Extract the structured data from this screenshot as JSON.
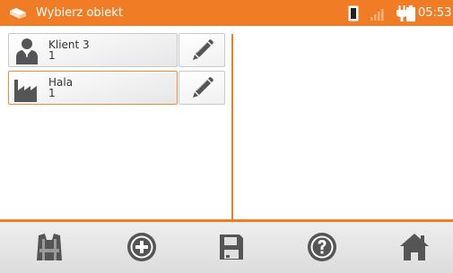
{
  "header": {
    "title": "Wybierz obiekt",
    "time": "05:53",
    "logo_icon": "app-logo-icon",
    "status_icons": [
      "memory-card-icon",
      "signal-strength-icon",
      "power-plug-icon",
      "battery-icon"
    ]
  },
  "items": [
    {
      "name": "Klient 3",
      "number": "1",
      "icon": "person-icon",
      "selected": false
    },
    {
      "name": "Hala",
      "number": "1",
      "icon": "factory-icon",
      "selected": true
    }
  ],
  "toolbar": {
    "buttons": [
      "vest-icon",
      "add-icon",
      "save-icon",
      "help-icon",
      "home-icon"
    ]
  },
  "colors": {
    "accent": "#f07c26",
    "icon_gray": "#555555",
    "selected_border": "#f08a3c"
  }
}
